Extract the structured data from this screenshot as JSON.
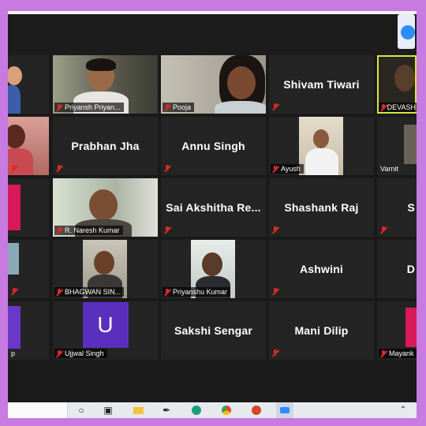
{
  "participants": {
    "priyansh": "Priyansh Priyan...",
    "pooja": "Pooja",
    "shivam": "Shivam Tiwari",
    "devash": "DEVASH",
    "prabhan": "Prabhan Jha",
    "annu": "Annu Singh",
    "ayush": "Ayush",
    "varnit": "Varnit",
    "naresh": "R. Naresh Kumar",
    "sai": "Sai Akshitha Re...",
    "shashank": "Shashank Raj",
    "s_partial": "S",
    "bhagwan": "BHAGWAN SIN...",
    "priyanshu": "Priyanshu Kumar",
    "ashwini": "Ashwini",
    "d_partial": "D",
    "ujjwal": "Ujjwal Singh",
    "ujjwal_initial": "U",
    "sakshi": "Sakshi Sengar",
    "mani": "Mani Dilip",
    "mayank": "Mayank",
    "p_partial": "p"
  },
  "colors": {
    "accent_zoom": "#2d8cff",
    "speaker_border": "#d6e545",
    "frame_bg": "#c77be0",
    "muted_mic": "#e02828",
    "avatar_u": "#5b2fbd"
  },
  "taskbar": {
    "icons": [
      "search-icon",
      "task-view-icon",
      "folder-icon",
      "pen-icon",
      "edge-icon",
      "chrome-icon",
      "powerpoint-icon",
      "zoom-icon",
      "chevron-up-icon"
    ]
  }
}
